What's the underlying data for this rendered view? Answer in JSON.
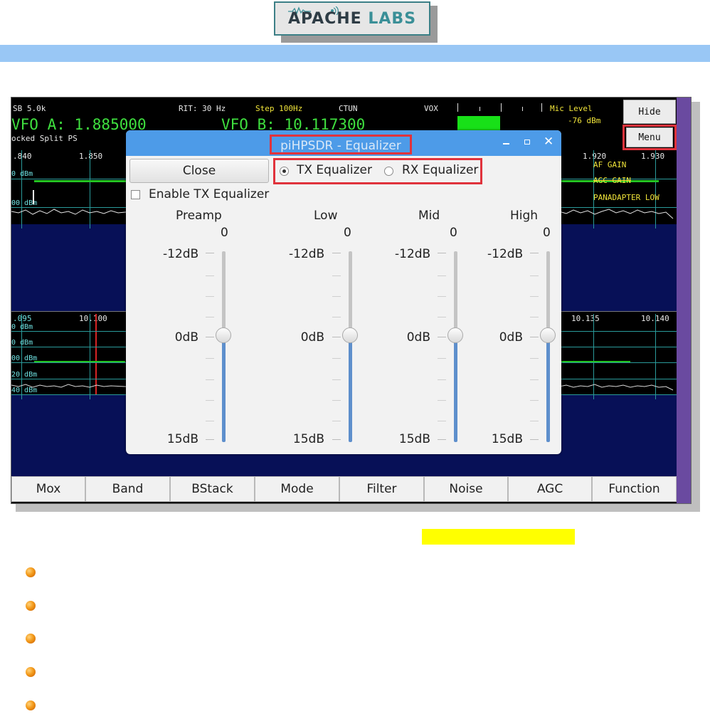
{
  "logo": {
    "text_main": "APACHE",
    "text_accent": "LABS"
  },
  "radio_top": {
    "mode_bw": "SB 5.0k",
    "rit": "RIT: 30 Hz",
    "step": "Step 100Hz",
    "ctun": "CTUN",
    "vox": "VOX",
    "mic_level_label": "Mic Level",
    "mic_level_value": "-76 dBm",
    "vfo_a": "VFO A: 1.885000",
    "vfo_b": "VFO B: 10.117300",
    "status_flags": "ocked Split  PS",
    "scale_top": [
      ".840",
      "1.850",
      "1.920",
      "1.930"
    ],
    "dbm_labels_top": [
      "0 dBm",
      "00 dBm"
    ],
    "scale_bottom": [
      ".095",
      "10.100",
      "10.135",
      "10.140"
    ],
    "dbm_labels_bottom": [
      "0 dBm",
      "0 dBm",
      "00 dBm",
      "20 dBm",
      "40 dBm"
    ],
    "overlay_right": [
      "AF GAIN",
      "AGC GAIN",
      "PANADAPTER LOW"
    ]
  },
  "side_buttons": {
    "hide": "Hide",
    "menu": "Menu"
  },
  "bottom_bar": [
    "Mox",
    "Band",
    "BStack",
    "Mode",
    "Filter",
    "Noise",
    "AGC",
    "Function"
  ],
  "dialog": {
    "title": "piHPSDR - Equalizer",
    "close_label": "Close",
    "tx_equalizer": "TX Equalizer",
    "rx_equalizer": "RX Equalizer",
    "selected": "TX Equalizer",
    "enable_label": "Enable TX Equalizer",
    "enable_checked": false,
    "bands": [
      {
        "name": "Preamp",
        "value": "0",
        "top": "-12dB",
        "mid": "0dB",
        "bottom": "15dB"
      },
      {
        "name": "Low",
        "value": "0",
        "top": "-12dB",
        "mid": "0dB",
        "bottom": "15dB"
      },
      {
        "name": "Mid",
        "value": "0",
        "top": "-12dB",
        "mid": "0dB",
        "bottom": "15dB"
      },
      {
        "name": "High",
        "value": "0",
        "top": "-12dB",
        "mid": "0dB",
        "bottom": "15dB"
      }
    ]
  },
  "colors": {
    "highlight_box": "#e0333c",
    "title_bar": "#4d9be8",
    "slider_fill": "#5e8fcc",
    "caption_highlight": "#ffff00"
  },
  "bullets": 5
}
